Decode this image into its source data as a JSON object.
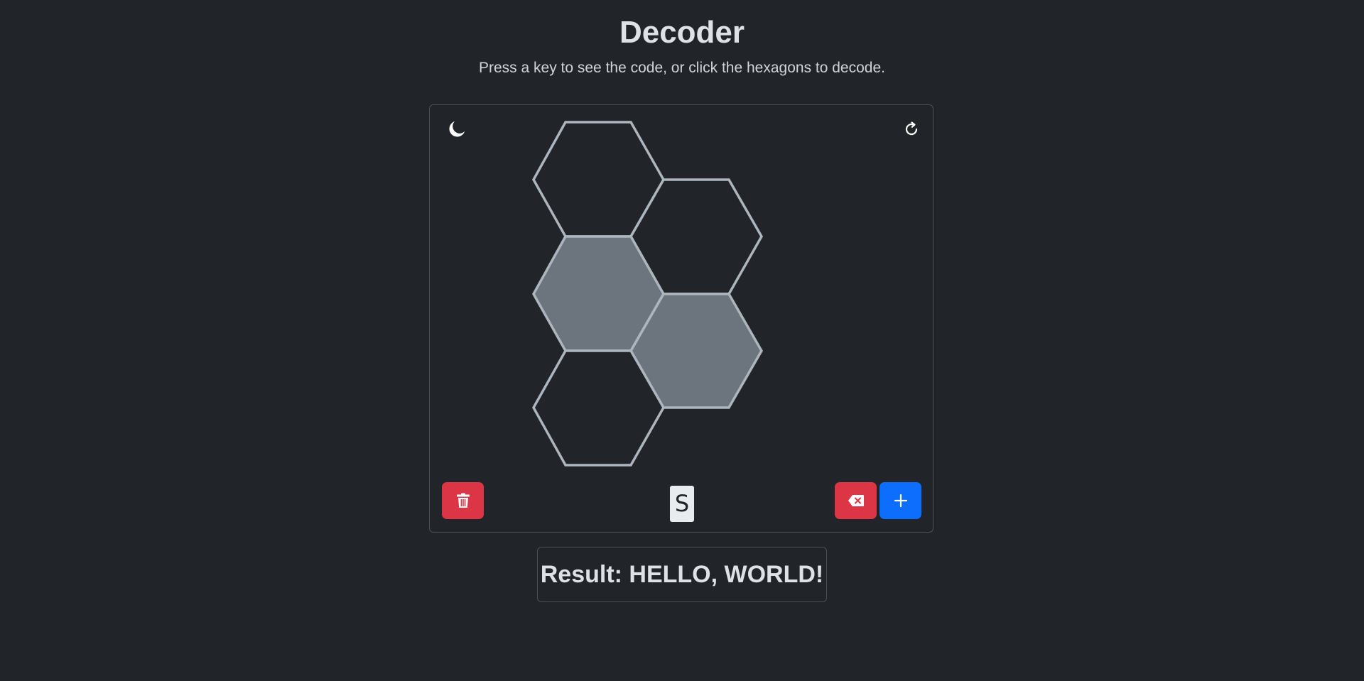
{
  "header": {
    "title": "Decoder",
    "subtitle": "Press a key to see the code, or click the hexagons to decode."
  },
  "toolbar": {
    "theme_icon": "moon-icon",
    "reset_icon": "refresh-icon"
  },
  "hexagons": [
    {
      "id": "hex-1",
      "active": false
    },
    {
      "id": "hex-2",
      "active": false
    },
    {
      "id": "hex-3",
      "active": true
    },
    {
      "id": "hex-4",
      "active": true
    },
    {
      "id": "hex-5",
      "active": false
    }
  ],
  "controls": {
    "clear_icon": "trash-icon",
    "backspace_icon": "backspace-icon",
    "add_icon": "plus-icon",
    "current_letter": "S"
  },
  "result": {
    "text": "Result: HELLO, WORLD!"
  },
  "colors": {
    "background": "#212529",
    "hex_active": "#6c757d",
    "hex_stroke": "#adb5bd",
    "danger": "#dc3545",
    "primary": "#0d6efd"
  }
}
